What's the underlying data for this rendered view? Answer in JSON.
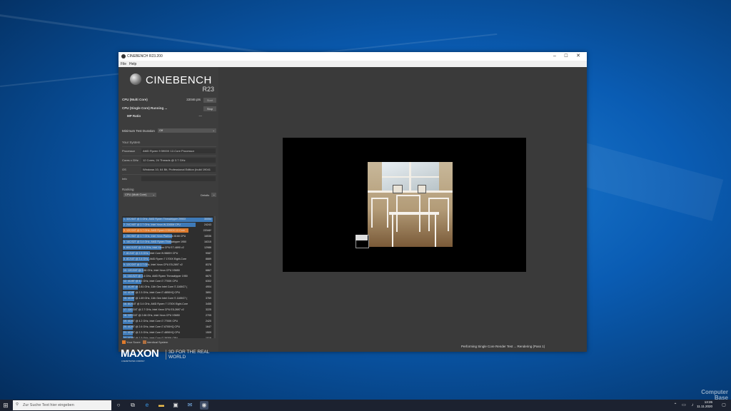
{
  "window": {
    "title": "CINEBENCH R23.200"
  },
  "menu": [
    "File",
    "Help"
  ],
  "logo": {
    "name": "CINEBENCH",
    "version": "R23"
  },
  "tests": {
    "multi": {
      "label": "CPU (Multi Core)",
      "score": "22046 pts",
      "button": "Start"
    },
    "single": {
      "label": "CPU (Single Core)",
      "status": "Running ...",
      "button": "Stop"
    },
    "mp_ratio": {
      "label": "MP Ratio",
      "value": "---"
    }
  },
  "min_duration": {
    "label": "Minimum Test Duration",
    "value": "Off"
  },
  "system": {
    "heading": "Your System",
    "rows": [
      {
        "key": "Processor",
        "value": "AMD Ryzen 9 5900X 12-Core Processor"
      },
      {
        "key": "Cores x GHz",
        "value": "12 Cores, 24 Threads @ 3.7 GHz"
      },
      {
        "key": "OS",
        "value": "Windows 10, 64 Bit, Professional Edition (build 19041"
      },
      {
        "key": "Info",
        "value": ""
      }
    ]
  },
  "ranking": {
    "heading": "Ranking",
    "select": "CPU (Multi Core)",
    "details": "Details",
    "items": [
      {
        "label": "1. 32C/64T @ 3 GHz, AMD Ryzen Threadripper 2990X",
        "score": "30054",
        "highlight": false
      },
      {
        "label": "2. 24C/48T @ 2.7 GHz, Intel Xeon W-3265M CPU",
        "score": "24243",
        "highlight": false
      },
      {
        "label": "3. 12C/24T @ 3.7 GHz, AMD Ryzen 9 5900X 12-Core",
        "score": "22046*",
        "highlight": true
      },
      {
        "label": "4. 28C/56T @ 2.7 GHz, Intel Xeon Platinum 8168 CPU",
        "score": "16536",
        "highlight": false
      },
      {
        "label": "5. 16C/32T @ 3.4 GHz, AMD Ryzen Threadripper 1950",
        "score": "16315",
        "highlight": false
      },
      {
        "label": "6. 60C/120T @ 2.8 GHz, Intel Xeon CPU E7-4890 v2",
        "score": "12986",
        "highlight": false
      },
      {
        "label": "7. 8C/16T @ 2.3 GHz, Intel Core i9-9880H CPU",
        "score": "9087",
        "highlight": false
      },
      {
        "label": "8. 8C/16T @ 3.4 GHz, AMD Ryzen 7 1700X Eight-Core",
        "score": "8889",
        "highlight": false
      },
      {
        "label": "9. 12C/24T @ 2.7 GHz, Intel Xeon CPU E5-2697 v2",
        "score": "8378",
        "highlight": false
      },
      {
        "label": "10. 12C/24T @ 2.66 GHz, Intel Xeon CPU X5650",
        "score": "6867",
        "highlight": false
      },
      {
        "label": "11. 16C/32T @ 3.4 GHz, AMD Ryzen Threadripper 1950",
        "score": "6670",
        "highlight": false
      },
      {
        "label": "12. 4C/8T @ 4.2 GHz, Intel Core i7-7700K CPU",
        "score": "6302",
        "highlight": false
      },
      {
        "label": "13. 4C/8T @ 2.81 GHz, 11th Gen Intel Core i7-1165G7 (",
        "score": "4904",
        "highlight": false
      },
      {
        "label": "14. 4C/8T @ 2.3 GHz, Intel Core i7-4850HQ CPU",
        "score": "3891",
        "highlight": false
      },
      {
        "label": "15. 4C/8T @ 1.69 GHz, 11th Gen Intel Core i7-1165G7 (",
        "score": "3769",
        "highlight": false
      },
      {
        "label": "16. 8C/16T @ 3.4 GHz, AMD Ryzen 7 1700X Eight-Core",
        "score": "3455",
        "highlight": false
      },
      {
        "label": "17. 12C/24T @ 2.7 GHz, Intel Xeon CPU E5-2697 v2",
        "score": "3225",
        "highlight": false
      },
      {
        "label": "18. 12C/24T @ 2.66 GHz, Intel Xeon CPU X5650",
        "score": "2705",
        "highlight": false
      },
      {
        "label": "19. 4C/8T @ 4.2 GHz, Intel Core i7-7700K CPU",
        "score": "2420",
        "highlight": false
      },
      {
        "label": "20. 4C/8T @ 2.6 GHz, Intel Core i7-6700HQ CPU",
        "score": "1647",
        "highlight": false
      },
      {
        "label": "21. 4C/8T @ 2.3 GHz, Intel Core i7-4850HQ CPU",
        "score": "1509",
        "highlight": false
      },
      {
        "label": "22. 4C/8T @ 2.3 GHz, Intel Core i7-3930K CPU",
        "score": "1016",
        "highlight": false
      }
    ]
  },
  "legend": {
    "your_score": "Your Score",
    "identical": "Identical System"
  },
  "footer": {
    "brand": "MAXON",
    "sub": "A NEMETSCHEK COMPANY",
    "tagline": "3D FOR THE REAL WORLD"
  },
  "status": "Performing Single Core Render Test ... Rendering (Pass 1)",
  "taskbar": {
    "search_placeholder": "Zur Suche Text hier eingeben",
    "time": "13:26",
    "date": "11.11.2020"
  },
  "watermark": [
    "Computer",
    "Base"
  ],
  "colors": {
    "bar": "#3e7ab8",
    "highlight": "#e07b2c",
    "window_bg": "#3a3a3a"
  }
}
